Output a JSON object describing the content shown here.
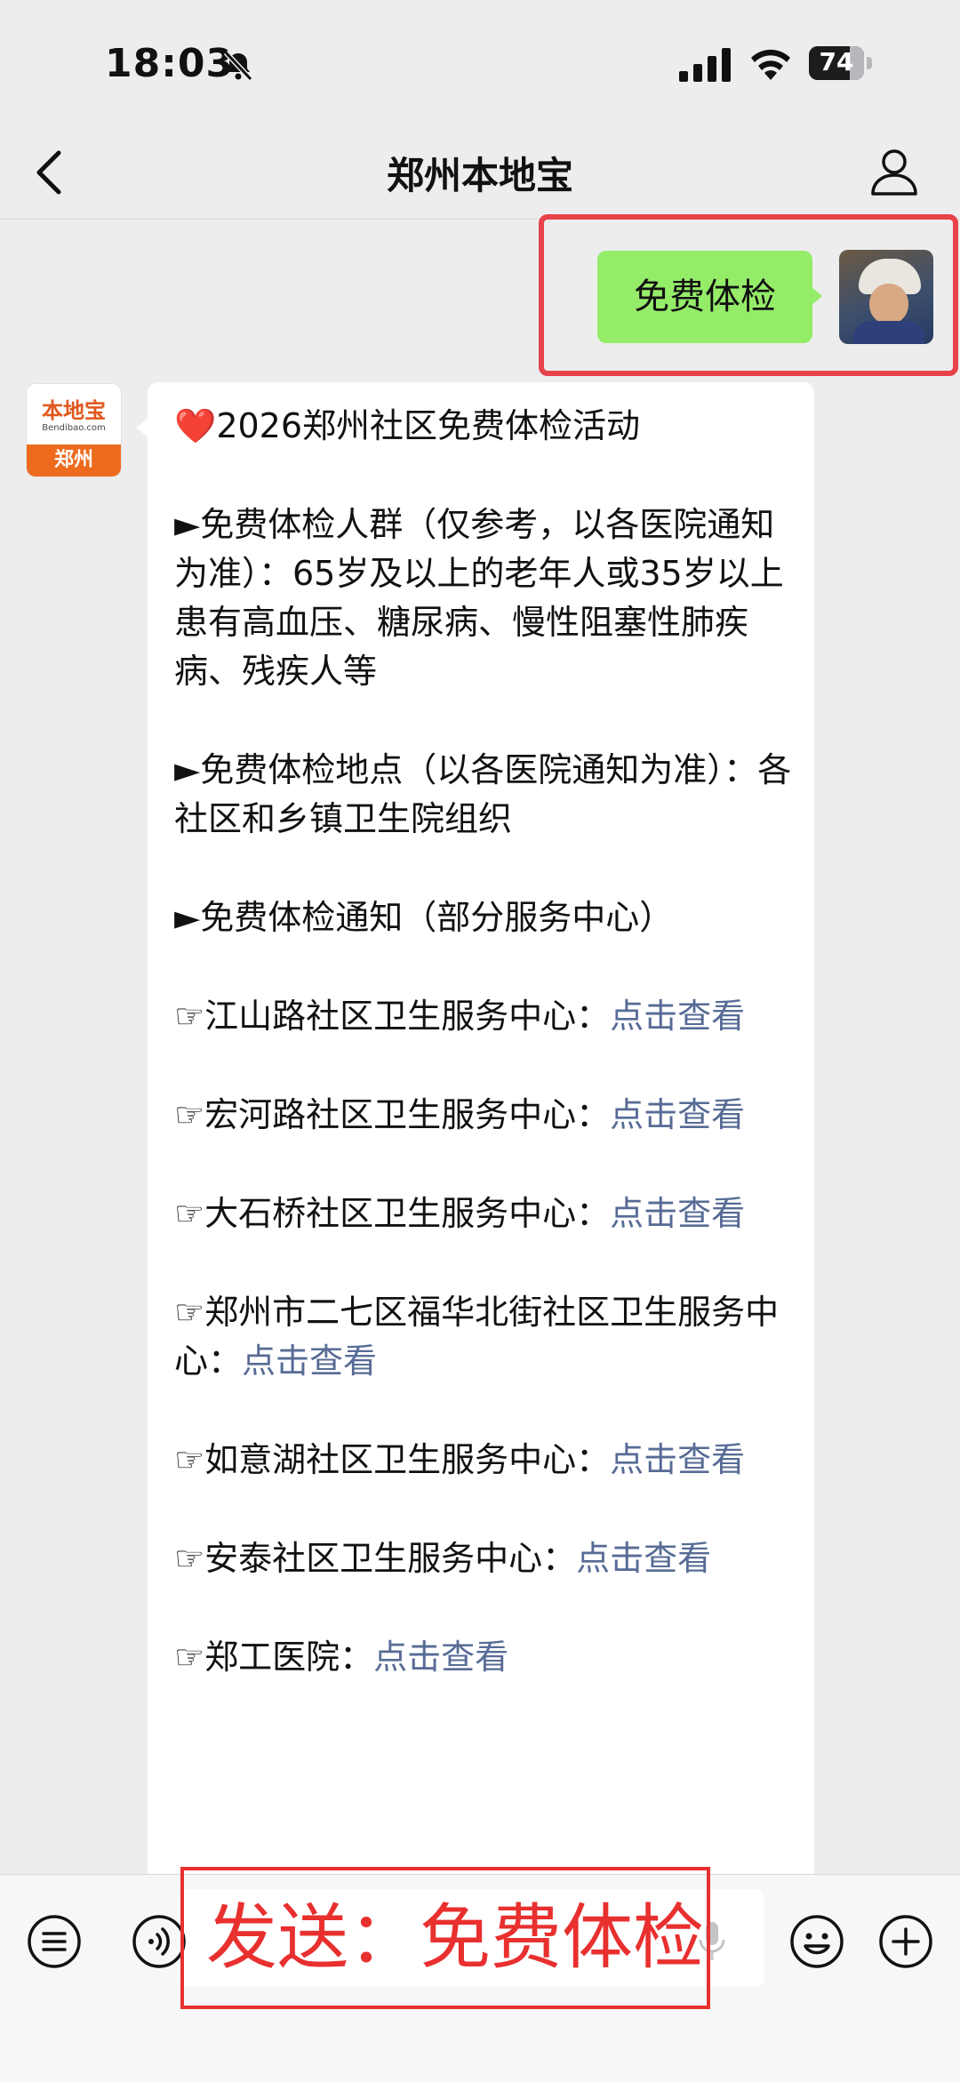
{
  "status_bar": {
    "time": "18:03",
    "battery": "74",
    "battery_level_percent": 74,
    "icons": [
      "bell-slash-icon",
      "signal-icon",
      "wifi-icon",
      "battery-icon"
    ]
  },
  "nav": {
    "title": "郑州本地宝",
    "icons": [
      "back-chevron-icon",
      "user-profile-icon"
    ]
  },
  "sent_message": {
    "text": "免费体检"
  },
  "bot_avatar": {
    "logo_text": "本地宝",
    "site_text": "Bendibao.com",
    "city_text": "郑州"
  },
  "reply": {
    "heart": "❤️",
    "title": "2026郑州社区免费体检活动",
    "sections": [
      "►免费体检人群（仅参考，以各医院通知为准）：65岁及以上的老年人或35岁以上患有高血压、糖尿病、慢性阻塞性肺疾病、残疾人等",
      "►免费体检地点（以各医院通知为准）：各社区和乡镇卫生院组织",
      "►免费体检通知（部分服务中心）"
    ],
    "centers": [
      {
        "name": "☞江山路社区卫生服务中心：",
        "link": "点击查看"
      },
      {
        "name": "☞宏河路社区卫生服务中心：",
        "link": "点击查看"
      },
      {
        "name": "☞大石桥社区卫生服务中心：",
        "link": "点击查看"
      },
      {
        "name": "☞郑州市二七区福华北街社区卫生服务中心：",
        "link": "点击查看"
      },
      {
        "name": "☞如意湖社区卫生服务中心：",
        "link": "点击查看"
      },
      {
        "name": "☞安泰社区卫生服务中心：",
        "link": "点击查看"
      },
      {
        "name": "☞郑工医院：",
        "link": "点击查看"
      }
    ]
  },
  "input_bar": {
    "overlay_text": "发送：免费体检",
    "icons": [
      "menu-list-icon",
      "voice-icon",
      "microphone-icon",
      "emoji-icon",
      "plus-icon"
    ]
  },
  "colors": {
    "sent_bubble": "#95ec69",
    "link": "#576b95",
    "highlight_red": "#e8424a",
    "background": "#ededed"
  }
}
